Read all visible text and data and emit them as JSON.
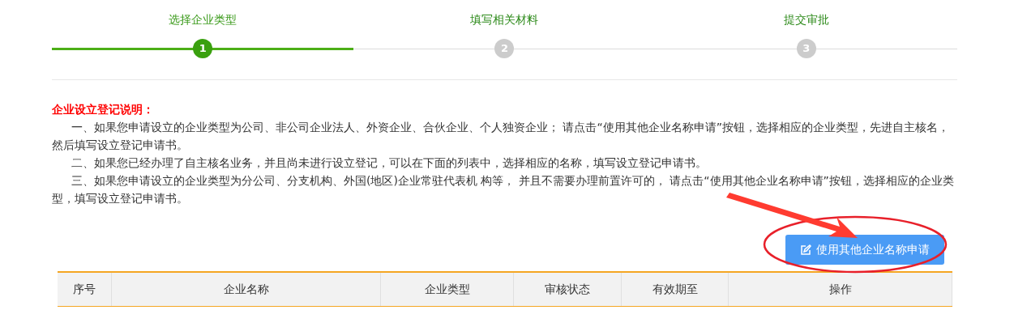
{
  "steps": [
    {
      "label": "选择企业类型",
      "number": "1",
      "selected": true
    },
    {
      "label": "填写相关材料",
      "number": "2",
      "selected": false
    },
    {
      "label": "提交审批",
      "number": "3",
      "selected": false
    }
  ],
  "instructions": {
    "title": "企业设立登记说明：",
    "paragraphs": [
      "一、如果您申请设立的企业类型为公司、非公司企业法人、外资企业、合伙企业、个人独资企业； 请点击“使用其他企业名称申请”按钮，选择相应的企业类型，先进自主核名，然后填写设立登记申请书。",
      "二、如果您已经办理了自主核名业务，并且尚未进行设立登记，可以在下面的列表中，选择相应的名称，填写设立登记申请书。",
      "三、如果您申请设立的企业类型为分公司、分支机构、外国(地区)企业常驻代表机 构等， 并且不需要办理前置许可的， 请点击“使用其他企业名称申请”按钮，选择相应的企业类型，填写设立登记申请书。"
    ]
  },
  "apply_button": {
    "label": "使用其他企业名称申请"
  },
  "table": {
    "columns": [
      "序号",
      "企业名称",
      "企业类型",
      "审核状态",
      "有效期至",
      "操作"
    ]
  }
}
